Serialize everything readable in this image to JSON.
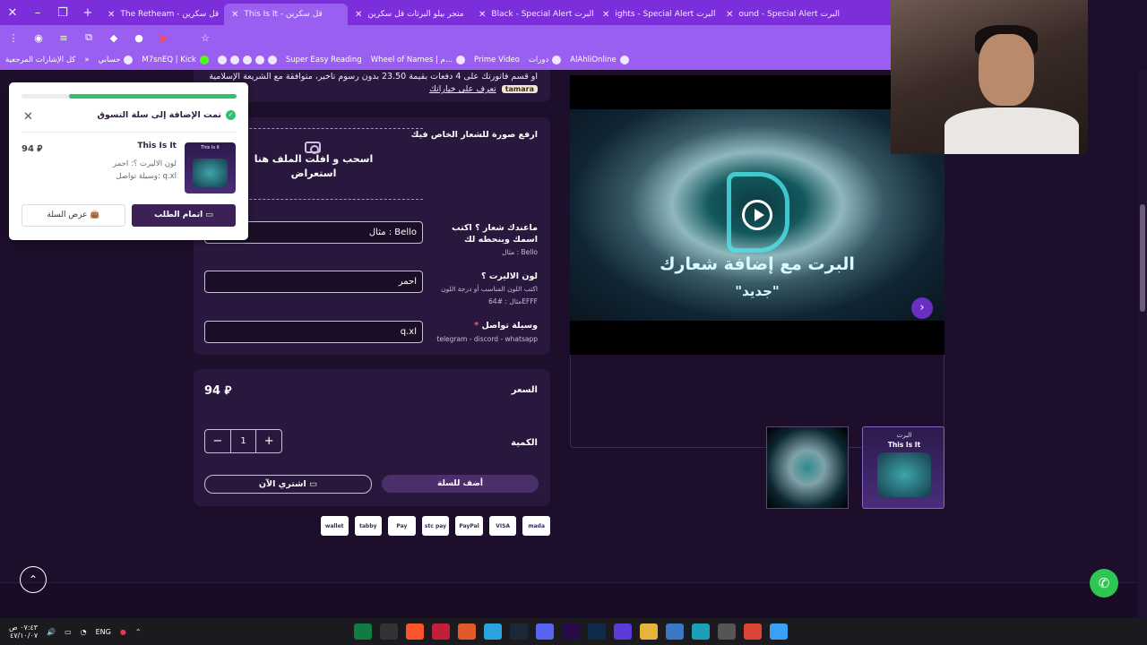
{
  "browser": {
    "tabs": [
      {
        "title": "The Retheam - قل سكرين",
        "active": false
      },
      {
        "title": "This Is It - قل سكرين",
        "active": true
      },
      {
        "title": "متجر بيلو البرتات قل سكرين",
        "active": false
      },
      {
        "title": "Black - Special Alert البرت",
        "active": false
      },
      {
        "title": "ights - Special Alert البرت",
        "active": false
      },
      {
        "title": "ound - Special Alert البرت",
        "active": false
      }
    ],
    "bookmarks": [
      "كل الإشارات المرجعية",
      "حسابي",
      "M7snEQ | Kick",
      "Super Easy Reading",
      "Wheel of Names | م...",
      "Prime Video",
      "دورات",
      "AlAhliOnline"
    ]
  },
  "tamara": {
    "line1": "او قسم فاتورتك على 4 دفعات بقيمة 23.50 بدون رسوم تاخير، متوافقة مع الشريعة الإسلامية",
    "badge": "tamara",
    "link": "تعرف على خياراتك"
  },
  "form": {
    "upload_label": "ارفع صورة للشعار الخاص فيك",
    "upload_text": "اسحب و افلت الملف هنا",
    "upload_browse": "استعراض",
    "name_label": "ماعندك شعار ؟ اكتب اسمك وبنحطه لك",
    "name_hint": "مثال : Bello",
    "name_placeholder": "مثال : Bello",
    "color_label": "لون الاليرت ؟",
    "color_hint1": "اكتب اللون المناسب أو درجة اللون",
    "color_hint2": "مثال : #64EFFF",
    "color_value": "احمر",
    "contact_label": "وسيلة تواصل",
    "contact_req": "*",
    "contact_hint": "telegram - discord - whatsapp",
    "contact_value": "q.xl"
  },
  "pricing": {
    "price_label": "السعر",
    "price": "94 ⃁",
    "qty_label": "الكمية",
    "qty": "1",
    "minus": "−",
    "plus": "+",
    "add_to_cart": "أضف للسلة",
    "buy_now": "اشتري الآن"
  },
  "payments": [
    "mada",
    "VISA",
    "PayPal",
    "stc pay",
    "Pay",
    "tabby",
    "wallet"
  ],
  "gallery": {
    "caption": "البرت مع إضافة شعارك",
    "subcaption": "\"جديد\"",
    "thumb2_title": "البرت",
    "thumb2_sub": "This Is It"
  },
  "cart_popup": {
    "progress": 0.78,
    "message": "تمت الإضافة إلى سلة التسوق",
    "product_name": "This Is It",
    "option_color": "لون الاليرت ؟: احمر",
    "option_contact": "وسيلة تواصل: q.xl",
    "price": "94 ⃁",
    "checkout": "اتمام الطلب",
    "view_cart": "عرض السلة"
  },
  "taskbar": {
    "lang": "ENG",
    "time": "٠٧:٤٣ ص",
    "date": "٤٧/١٠/٠٧"
  }
}
